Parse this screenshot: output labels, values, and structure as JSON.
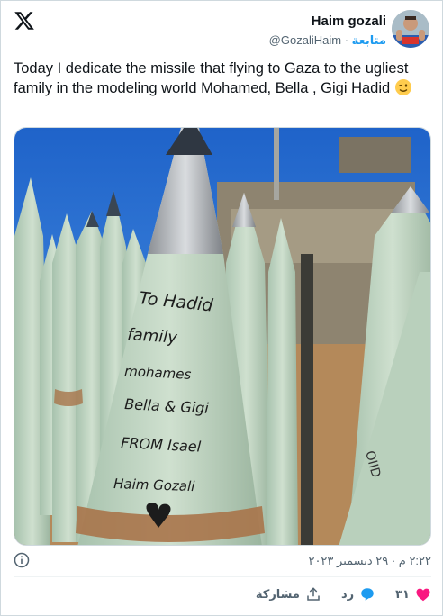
{
  "author": {
    "name": "Haim gozali",
    "handle": "@GozaliHaim",
    "separator": "·",
    "follow_label": "متابعة"
  },
  "tweet": {
    "text": "Today I dedicate the missile that flying to Gaza to the ugliest family in the modeling world  Mohamed, Bella , Gigi Hadid",
    "emoji": "winking-face"
  },
  "media": {
    "handwriting": [
      "To Hadid",
      "family",
      "mohames",
      "Bella & Gigi",
      "FROM Isael",
      "Haim Gozali"
    ],
    "side_text": "OIID"
  },
  "info": {
    "timestamp": "٢:٢٢ م · ٢٩ ديسمبر ٢٠٢٣"
  },
  "actions": {
    "like_count": "٣١",
    "reply_label": "رد",
    "share_label": "مشاركة"
  },
  "colors": {
    "follow": "#1d9bf0",
    "like": "#f91880",
    "reply": "#1d9bf0",
    "text": "#0f1419",
    "muted": "#536471"
  }
}
